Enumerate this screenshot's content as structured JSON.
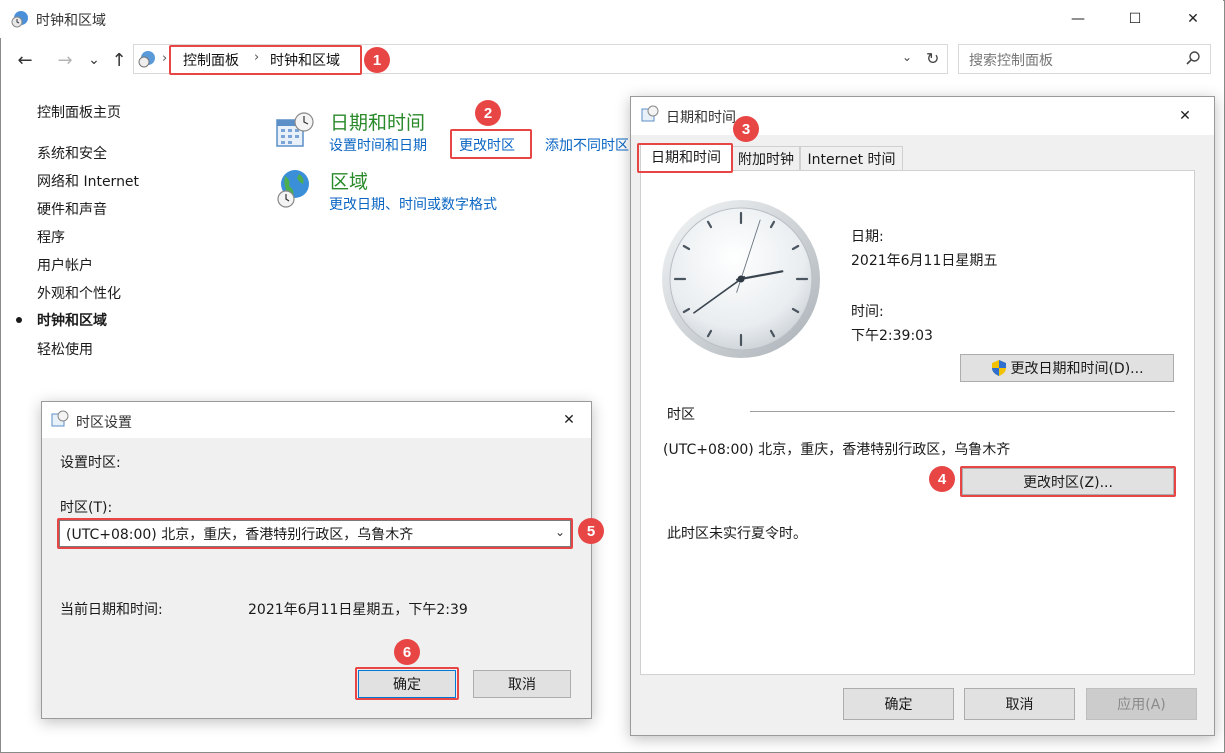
{
  "window": {
    "title": "时钟和区域",
    "minimize": "—",
    "maximize": "☐",
    "close": "✕"
  },
  "nav": {
    "back": "←",
    "forward": "→",
    "recent": "⌄",
    "up": "↑",
    "breadcrumb": [
      "控制面板",
      "时钟和区域"
    ],
    "search_placeholder": "搜索控制面板"
  },
  "sidebar": {
    "home": "控制面板主页",
    "items": [
      "系统和安全",
      "网络和 Internet",
      "硬件和声音",
      "程序",
      "用户帐户",
      "外观和个性化",
      "时钟和区域",
      "轻松使用"
    ],
    "active": "时钟和区域"
  },
  "categories": {
    "datetime": {
      "title": "日期和时间",
      "links": [
        "设置时间和日期",
        "更改时区",
        "添加不同时区"
      ]
    },
    "region": {
      "title": "区域",
      "links": [
        "更改日期、时间或数字格式"
      ]
    }
  },
  "datetime_dialog": {
    "title": "日期和时间",
    "close": "✕",
    "tabs": [
      "日期和时间",
      "附加时钟",
      "Internet 时间"
    ],
    "date_label": "日期:",
    "date_value": "2021年6月11日星期五",
    "time_label": "时间:",
    "time_value": "下午2:39:03",
    "change_datetime_button": "更改日期和时间(D)...",
    "timezone_section": "时区",
    "timezone_value": "(UTC+08:00) 北京，重庆，香港特别行政区，乌鲁木齐",
    "change_timezone_button": "更改时区(Z)...",
    "dst_note": "此时区未实行夏令时。",
    "ok": "确定",
    "cancel": "取消",
    "apply": "应用(A)"
  },
  "timezone_dialog": {
    "title": "时区设置",
    "close": "✕",
    "set_label": "设置时区:",
    "tz_label": "时区(T):",
    "tz_selected": "(UTC+08:00) 北京，重庆，香港特别行政区，乌鲁木齐",
    "current_label": "当前日期和时间:",
    "current_value": "2021年6月11日星期五，下午2:39",
    "ok": "确定",
    "cancel": "取消"
  },
  "annotations": [
    "1",
    "2",
    "3",
    "4",
    "5",
    "6"
  ],
  "colors": {
    "annotation_red": "#e84545",
    "link_blue": "#0b66c3",
    "category_green": "#2a8a2a"
  },
  "clock": {
    "hour": 2,
    "minute": 39,
    "second": 3
  }
}
